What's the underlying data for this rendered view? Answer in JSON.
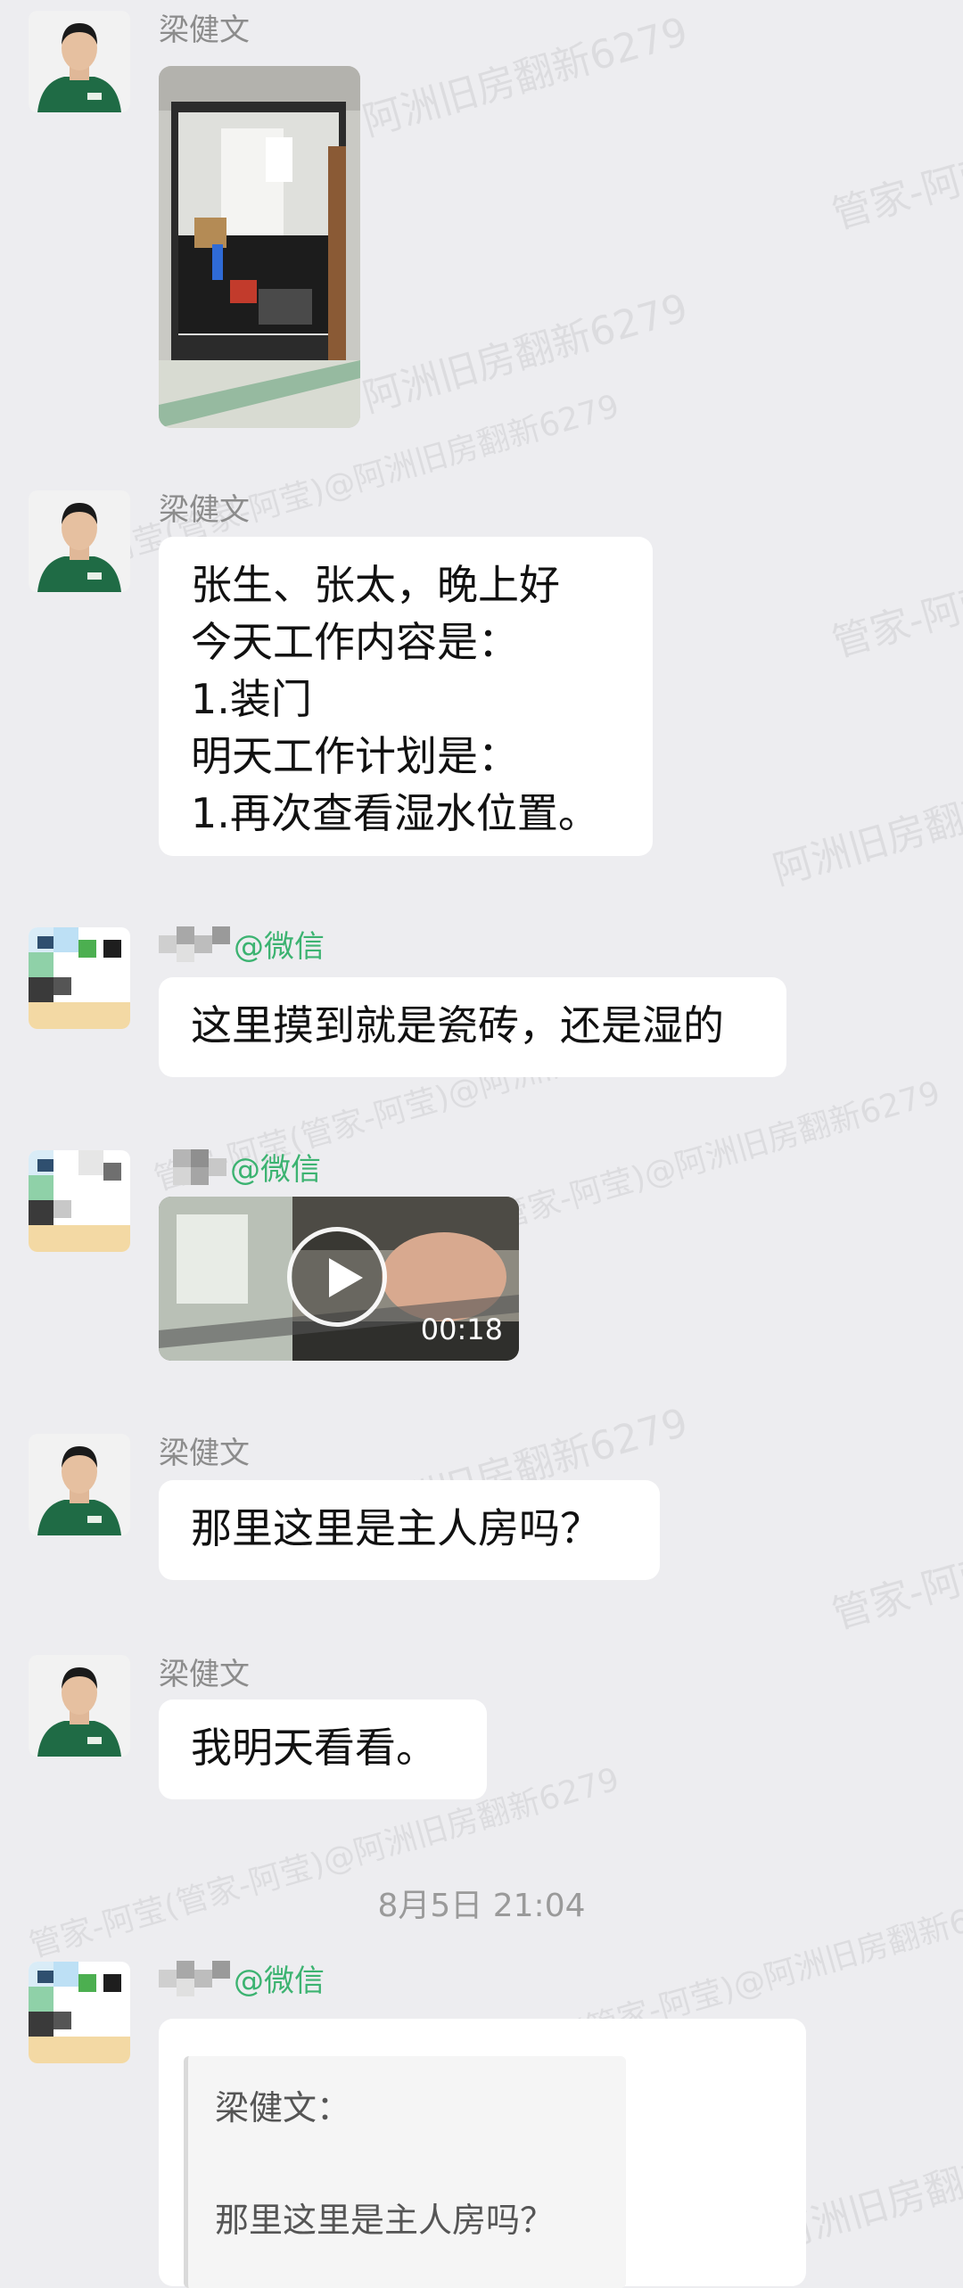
{
  "watermarks": [
    "阿洲旧房翻新6279",
    "管家-阿莹",
    "管家-阿莹(管家-阿莹)@阿洲旧房翻新6279",
    "管家-阿莹(管家-阿莹)@阿洲旧房翻新6279",
    "阿洲旧房翻新6279",
    "管家-阿莹",
    "管家-阿莹(管家-阿莹)@阿洲旧房翻新6279",
    "阿洲旧房翻新6279",
    "管家-阿莹(管家-阿莹)@阿洲旧房翻新6279",
    "阿洲旧房翻新6279",
    "管家-阿莹",
    "管家-阿莹(管家-阿莹)@阿洲旧房翻新6279",
    "阿洲旧房翻新6279"
  ],
  "messages": {
    "m1": {
      "sender": "梁健文",
      "type": "image",
      "icon": "photo-kitchen-doorway"
    },
    "m2": {
      "sender": "梁健文",
      "lines": [
        "张生、张太，晚上好",
        "今天工作内容是：",
        "1.装门",
        "明天工作计划是：",
        "1.再次查看湿水位置。"
      ]
    },
    "m3": {
      "sender_suffix": "@微信",
      "text": "这里摸到就是瓷砖，还是湿的"
    },
    "m4": {
      "sender_suffix": "@微信",
      "type": "video",
      "duration": "00:18"
    },
    "m5": {
      "sender": "梁健文",
      "text": "那里这里是主人房吗？"
    },
    "m6": {
      "sender": "梁健文",
      "text": "我明天看看。"
    },
    "timestamp": "8月5日  21:04",
    "m7": {
      "sender_suffix": "@微信",
      "quote_author": "梁健文：",
      "quote_text": "那里这里是主人房吗？"
    }
  },
  "colors": {
    "background": "#ededf0",
    "bubble": "#ffffff",
    "wechat_green": "#3cb371",
    "name_gray": "#8c8c8c"
  }
}
